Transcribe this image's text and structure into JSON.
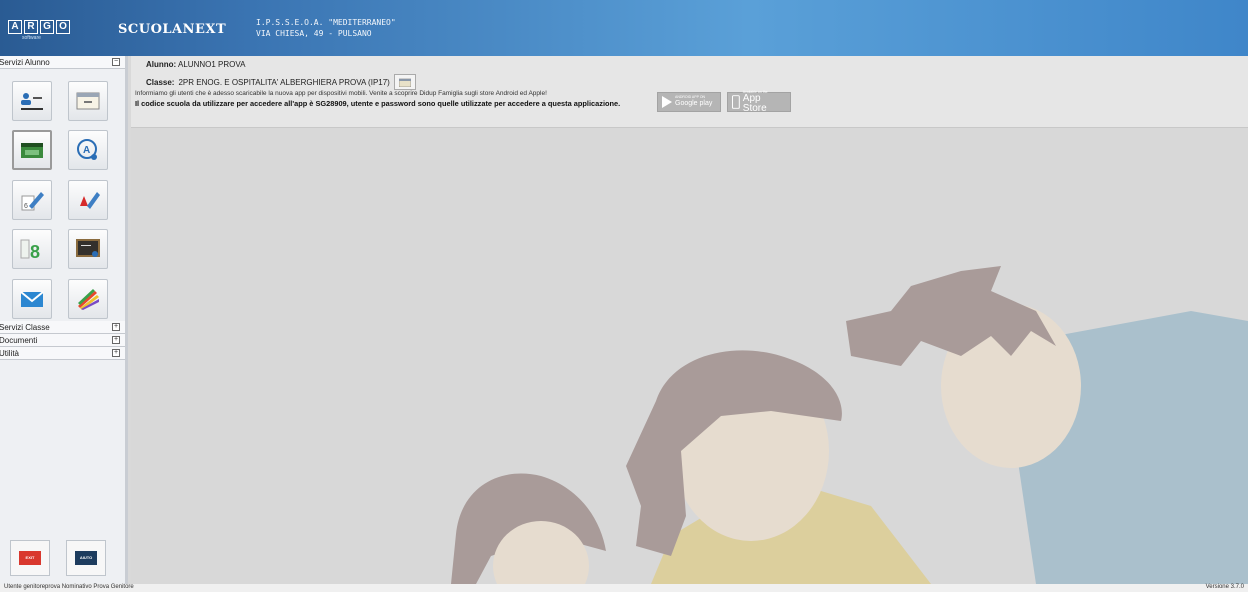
{
  "header": {
    "logo_letters": [
      "A",
      "R",
      "G",
      "O"
    ],
    "logo_sub": "software",
    "app_title": "SCUOLANEXT",
    "school_name": "I.P.S.S.E.O.A. \"MEDITERRANEO\"",
    "school_address": "VIA CHIESA, 49 - PULSANO"
  },
  "sidebar": {
    "sections": [
      {
        "label": "Servizi Alunno",
        "toggle": "−"
      },
      {
        "label": "Servizi Classe",
        "toggle": "+"
      },
      {
        "label": "Documenti",
        "toggle": "+"
      },
      {
        "label": "Utilità",
        "toggle": "+"
      }
    ],
    "icons": [
      "student-profile-icon",
      "notebook-icon",
      "attendance-icon",
      "student-search-icon",
      "grades-pencil-icon",
      "notes-marker-icon",
      "grade-8-icon",
      "blackboard-icon",
      "mail-envelope-icon",
      "colored-pencils-icon"
    ],
    "bottom_buttons": {
      "exit": "EXIT",
      "help": "AIUTO"
    }
  },
  "main": {
    "alunno_label": "Alunno:",
    "alunno_value": "ALUNNO1 PROVA",
    "classe_label": "Classe:",
    "classe_value": "2PR ENOG. E OSPITALITA' ALBERGHIERA PROVA (IP17)",
    "info_line1": "Informiamo gli utenti che è adesso scaricabile la nuova app per dispositivi mobili. Venite a scoprire Didup Famiglia sugli store Android ed Apple!",
    "info_line2": "Il codice scuola da utilizzare per accedere all'app è SG28909, utente e password sono quelle utilizzate per accedere a questa applicazione.",
    "google_small": "ANDROID APP ON",
    "google_big": "Google play",
    "apple_small": "Available on the",
    "apple_big": "App Store"
  },
  "status": {
    "left": "Utente genitoreprova Nominativo Prova Genitore",
    "right": "Versione 3.7.0"
  },
  "colors": {
    "header": "#3a74b2",
    "background": "#d8d8d8",
    "skin": "#e6dccf",
    "hair": "#a99b99",
    "shirt_blue": "#aac0cc",
    "shirt_yellow": "#dccf9d"
  }
}
